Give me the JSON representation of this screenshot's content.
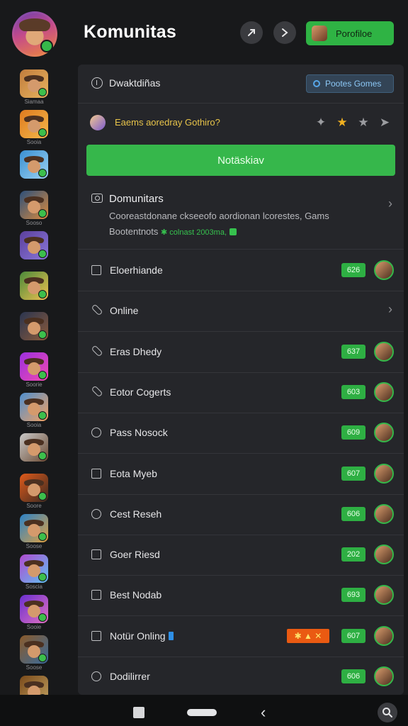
{
  "header": {
    "title": "Komunitas",
    "profile_button_label": "Porofiloe"
  },
  "sidebar": {
    "items": [
      {
        "caption": "Siamaa",
        "colors": [
          "#c27c3d",
          "#e6b35e"
        ]
      },
      {
        "caption": "Sooia",
        "colors": [
          "#e07a1f",
          "#f2b84a"
        ]
      },
      {
        "caption": "",
        "colors": [
          "#3a8fd1",
          "#9ad1f2"
        ]
      },
      {
        "caption": "Sooso",
        "colors": [
          "#2c4f7a",
          "#d98b3f"
        ]
      },
      {
        "caption": "",
        "colors": [
          "#5b3f9c",
          "#8a78d9"
        ]
      },
      {
        "caption": "",
        "colors": [
          "#4a8a3a",
          "#f0c050"
        ]
      },
      {
        "caption": "",
        "colors": [
          "#2a3550",
          "#8b5a3a"
        ]
      },
      {
        "caption": "Soorie",
        "colors": [
          "#9b2fe0",
          "#f04ab0"
        ]
      },
      {
        "caption": "Sooia",
        "colors": [
          "#4e8fd0",
          "#f2a060"
        ]
      },
      {
        "caption": "",
        "colors": [
          "#c9c9c9",
          "#6b4a32"
        ]
      },
      {
        "caption": "Soore",
        "colors": [
          "#e05a1a",
          "#3a2a22"
        ]
      },
      {
        "caption": "Soose",
        "colors": [
          "#2a82c8",
          "#e0a040"
        ]
      },
      {
        "caption": "Soscia",
        "colors": [
          "#b04ad0",
          "#60c0f0"
        ]
      },
      {
        "caption": "Sooie",
        "colors": [
          "#6a2fd0",
          "#e070c0"
        ]
      },
      {
        "caption": "Soose",
        "colors": [
          "#8a5a2a",
          "#3a6a9a"
        ]
      },
      {
        "caption": "",
        "colors": [
          "#7a4a1a",
          "#c0a060"
        ]
      }
    ]
  },
  "panel": {
    "dash_label": "Dwaktdiñas",
    "pill_button": "Pootes Gomes",
    "question": "Eaems aoredray Gothiro?",
    "cta_label": "Notäskiav",
    "section": {
      "title": "Domunitars",
      "desc_line1": "Cooreastdonane ckseeofo aordionan lcorestes, Gams",
      "desc_line2_main": "Bootentnots",
      "desc_line2_accent": "✱ colnast 2003ma,"
    },
    "rows": [
      {
        "label": "Eloerhiande",
        "badge": "626",
        "icon": "square",
        "chevron": false
      },
      {
        "label": "Online",
        "badge": "",
        "icon": "clip",
        "chevron": true
      },
      {
        "label": "Eras Dhedy",
        "badge": "637",
        "icon": "clip",
        "chevron": false
      },
      {
        "label": "Eotor Cogerts",
        "badge": "603",
        "icon": "clip",
        "chevron": false
      },
      {
        "label": "Pass Nosock",
        "badge": "609",
        "icon": "circle",
        "chevron": false
      },
      {
        "label": "Eota Myeb",
        "badge": "607",
        "icon": "square",
        "chevron": false
      },
      {
        "label": "Cest Reseh",
        "badge": "606",
        "icon": "circle",
        "chevron": false
      },
      {
        "label": "Goer Riesd",
        "badge": "202",
        "icon": "square",
        "chevron": false
      },
      {
        "label": "Best Nodab",
        "badge": "693",
        "icon": "square",
        "chevron": false
      },
      {
        "label": "Notür Onling",
        "badge": "607",
        "icon": "square",
        "chevron": false,
        "promo": "✱ ▲ ✕"
      },
      {
        "label": "Dodilirrer",
        "badge": "606",
        "icon": "circle",
        "chevron": false
      }
    ]
  },
  "colors": {
    "accent_green": "#36b74b",
    "background": "#18191b",
    "panel": "#25262a"
  }
}
